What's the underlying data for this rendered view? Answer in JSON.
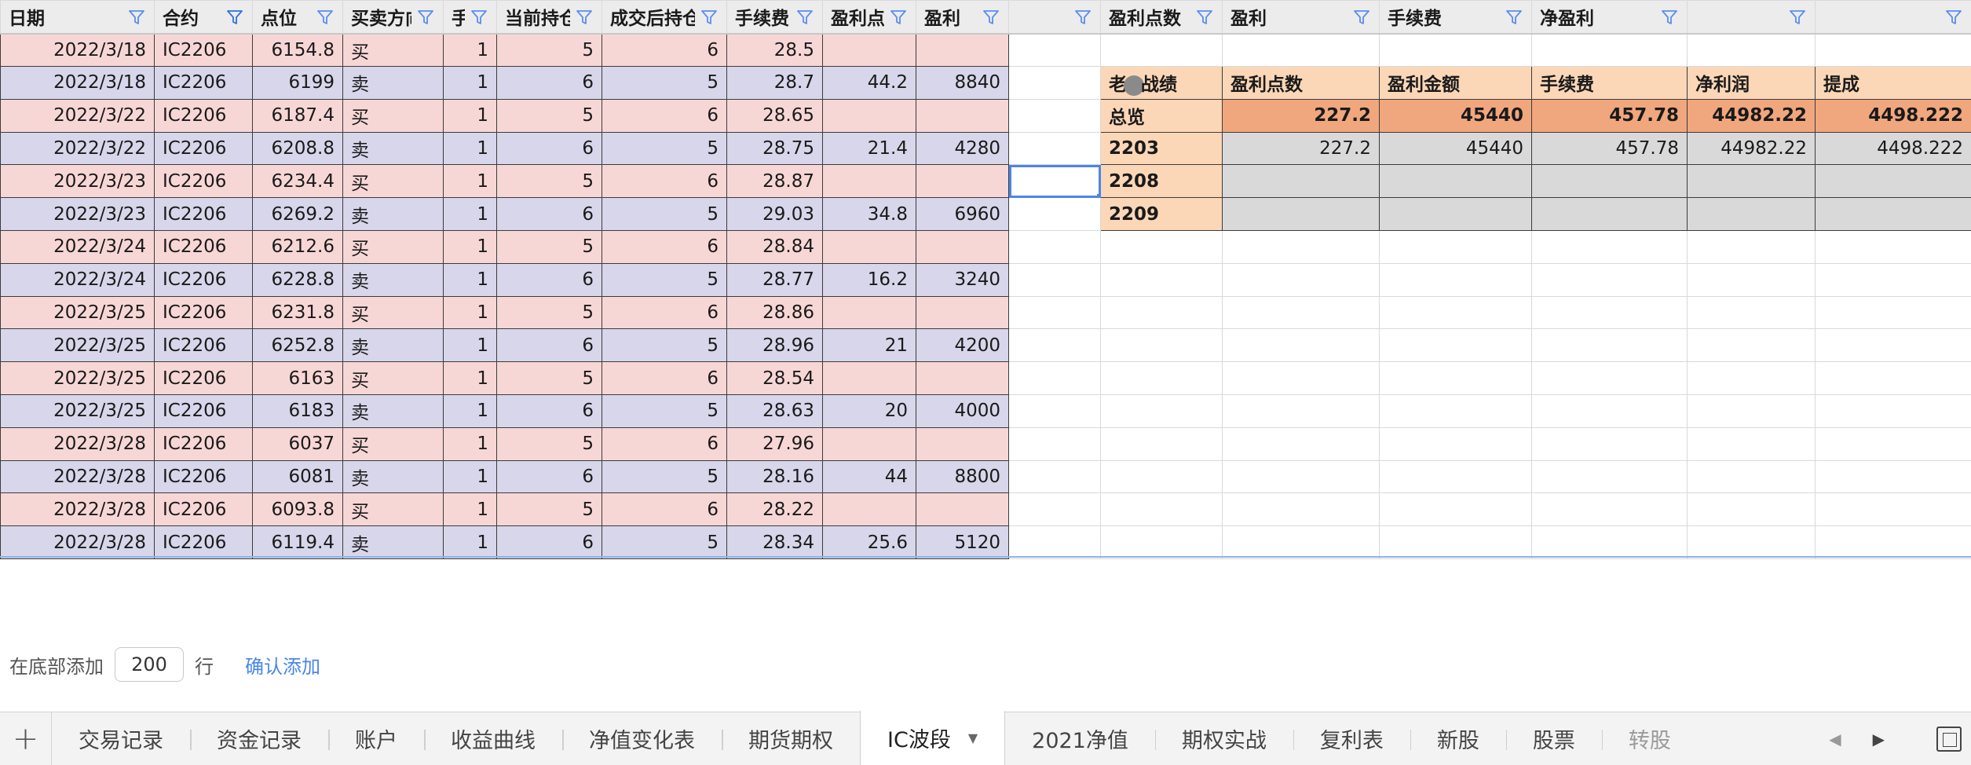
{
  "headers": [
    "日期",
    "合约",
    "点位",
    "买卖方向",
    "手",
    "当前持仓",
    "成交后持仓",
    "手续费",
    "盈利点",
    "盈利",
    "",
    "盈利点数",
    "盈利",
    "手续费",
    "净盈利",
    "",
    ""
  ],
  "trades": [
    {
      "date": "2022/3/18",
      "contract": "IC2206",
      "price": "6154.8",
      "side": "买",
      "lots": "1",
      "cur": "5",
      "after": "6",
      "fee": "28.5",
      "pts": "",
      "profit": ""
    },
    {
      "date": "2022/3/18",
      "contract": "IC2206",
      "price": "6199",
      "side": "卖",
      "lots": "1",
      "cur": "6",
      "after": "5",
      "fee": "28.7",
      "pts": "44.2",
      "profit": "8840"
    },
    {
      "date": "2022/3/22",
      "contract": "IC2206",
      "price": "6187.4",
      "side": "买",
      "lots": "1",
      "cur": "5",
      "after": "6",
      "fee": "28.65",
      "pts": "",
      "profit": ""
    },
    {
      "date": "2022/3/22",
      "contract": "IC2206",
      "price": "6208.8",
      "side": "卖",
      "lots": "1",
      "cur": "6",
      "after": "5",
      "fee": "28.75",
      "pts": "21.4",
      "profit": "4280"
    },
    {
      "date": "2022/3/23",
      "contract": "IC2206",
      "price": "6234.4",
      "side": "买",
      "lots": "1",
      "cur": "5",
      "after": "6",
      "fee": "28.87",
      "pts": "",
      "profit": ""
    },
    {
      "date": "2022/3/23",
      "contract": "IC2206",
      "price": "6269.2",
      "side": "卖",
      "lots": "1",
      "cur": "6",
      "after": "5",
      "fee": "29.03",
      "pts": "34.8",
      "profit": "6960"
    },
    {
      "date": "2022/3/24",
      "contract": "IC2206",
      "price": "6212.6",
      "side": "买",
      "lots": "1",
      "cur": "5",
      "after": "6",
      "fee": "28.84",
      "pts": "",
      "profit": ""
    },
    {
      "date": "2022/3/24",
      "contract": "IC2206",
      "price": "6228.8",
      "side": "卖",
      "lots": "1",
      "cur": "6",
      "after": "5",
      "fee": "28.77",
      "pts": "16.2",
      "profit": "3240"
    },
    {
      "date": "2022/3/25",
      "contract": "IC2206",
      "price": "6231.8",
      "side": "买",
      "lots": "1",
      "cur": "5",
      "after": "6",
      "fee": "28.86",
      "pts": "",
      "profit": ""
    },
    {
      "date": "2022/3/25",
      "contract": "IC2206",
      "price": "6252.8",
      "side": "卖",
      "lots": "1",
      "cur": "6",
      "after": "5",
      "fee": "28.96",
      "pts": "21",
      "profit": "4200"
    },
    {
      "date": "2022/3/25",
      "contract": "IC2206",
      "price": "6163",
      "side": "买",
      "lots": "1",
      "cur": "5",
      "after": "6",
      "fee": "28.54",
      "pts": "",
      "profit": ""
    },
    {
      "date": "2022/3/25",
      "contract": "IC2206",
      "price": "6183",
      "side": "卖",
      "lots": "1",
      "cur": "6",
      "after": "5",
      "fee": "28.63",
      "pts": "20",
      "profit": "4000"
    },
    {
      "date": "2022/3/28",
      "contract": "IC2206",
      "price": "6037",
      "side": "买",
      "lots": "1",
      "cur": "5",
      "after": "6",
      "fee": "27.96",
      "pts": "",
      "profit": ""
    },
    {
      "date": "2022/3/28",
      "contract": "IC2206",
      "price": "6081",
      "side": "卖",
      "lots": "1",
      "cur": "6",
      "after": "5",
      "fee": "28.16",
      "pts": "44",
      "profit": "8800"
    },
    {
      "date": "2022/3/28",
      "contract": "IC2206",
      "price": "6093.8",
      "side": "买",
      "lots": "1",
      "cur": "5",
      "after": "6",
      "fee": "28.22",
      "pts": "",
      "profit": ""
    },
    {
      "date": "2022/3/28",
      "contract": "IC2206",
      "price": "6119.4",
      "side": "卖",
      "lots": "1",
      "cur": "6",
      "after": "5",
      "fee": "28.34",
      "pts": "25.6",
      "profit": "5120"
    }
  ],
  "summary": {
    "title_prefix": "老",
    "title_suffix": "战绩",
    "columns": [
      "盈利点数",
      "盈利金额",
      "手续费",
      "净利润",
      "提成"
    ],
    "rows": [
      {
        "label": "总览",
        "values": [
          "227.2",
          "45440",
          "457.78",
          "44982.22",
          "4498.222"
        ]
      },
      {
        "label": "2203",
        "values": [
          "227.2",
          "45440",
          "457.78",
          "44982.22",
          "4498.222"
        ]
      },
      {
        "label": "2208",
        "values": [
          "",
          "",
          "",
          "",
          ""
        ]
      },
      {
        "label": "2209",
        "values": [
          "",
          "",
          "",
          "",
          ""
        ]
      }
    ]
  },
  "add_rows": {
    "prefix": "在底部添加",
    "count": "200",
    "suffix": "行",
    "confirm": "确认添加"
  },
  "tabs": [
    {
      "label": "交易记录",
      "active": false
    },
    {
      "label": "资金记录",
      "active": false
    },
    {
      "label": "账户",
      "active": false
    },
    {
      "label": "收益曲线",
      "active": false
    },
    {
      "label": "净值变化表",
      "active": false
    },
    {
      "label": "期货期权",
      "active": false
    },
    {
      "label": "IC波段",
      "active": true
    },
    {
      "label": "2021净值",
      "active": false
    },
    {
      "label": "期权实战",
      "active": false
    },
    {
      "label": "复利表",
      "active": false
    },
    {
      "label": "新股",
      "active": false
    },
    {
      "label": "股票",
      "active": false
    },
    {
      "label": "转股",
      "active": false
    }
  ],
  "colors": {
    "buy_row": "#f7d7d6",
    "sell_row": "#d7d6ea",
    "summary_label": "#fbd7b7",
    "summary_overview": "#f1a77d",
    "summary_value": "#d9d9d9",
    "filter_icon": "#5b8def",
    "link": "#4a86e8"
  }
}
